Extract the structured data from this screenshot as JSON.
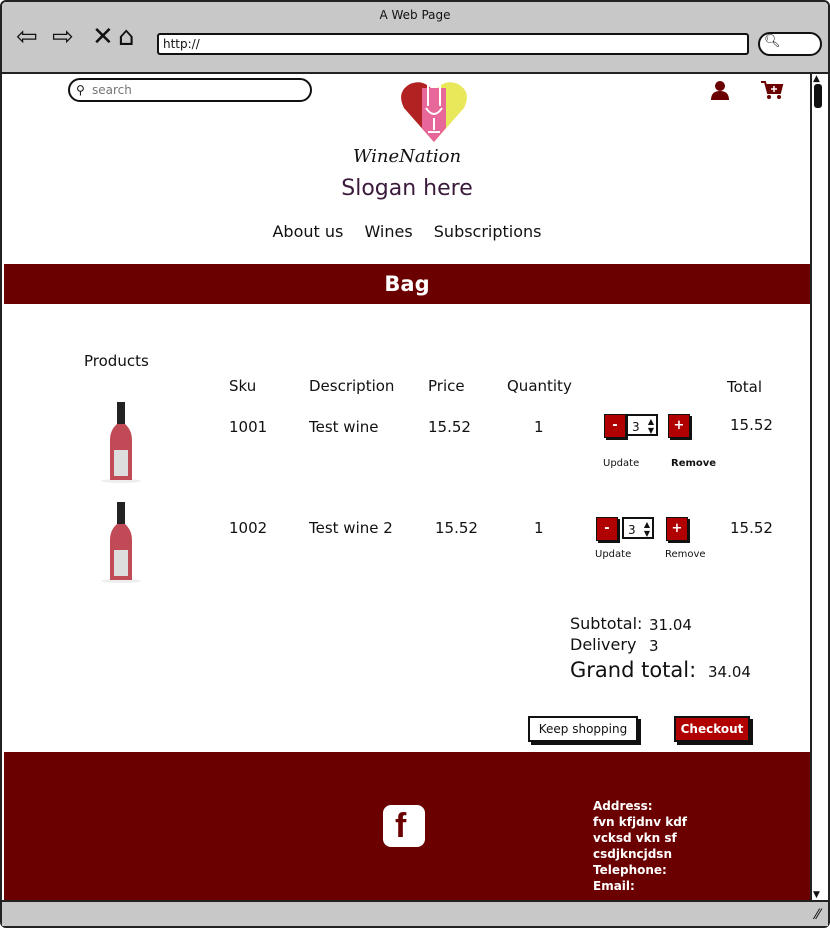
{
  "window": {
    "title": "A Web Page",
    "url": "http://"
  },
  "header": {
    "search_placeholder": "search",
    "brand": "WineNation",
    "slogan": "Slogan here",
    "nav": [
      "About us",
      "Wines",
      "Subscriptions"
    ]
  },
  "bag": {
    "title": "Bag",
    "products_label": "Products",
    "columns": {
      "sku": "Sku",
      "description": "Description",
      "price": "Price",
      "quantity": "Quantity",
      "total": "Total"
    },
    "items": [
      {
        "sku": "1001",
        "description": "Test wine",
        "price": "15.52",
        "quantity": "1",
        "stepper_value": "3",
        "total": "15.52",
        "update": "Update",
        "remove": "Remove"
      },
      {
        "sku": "1002",
        "description": "Test wine 2",
        "price": "15.52",
        "quantity": "1",
        "stepper_value": "3",
        "total": "15.52",
        "update": "Update",
        "remove": "Remove"
      }
    ],
    "stepper": {
      "minus": "-",
      "plus": "+"
    },
    "summary": {
      "subtotal_label": "Subtotal:",
      "subtotal": "31.04",
      "delivery_label": "Delivery",
      "delivery": "3",
      "grand_label": "Grand total:",
      "grand": "34.04"
    },
    "keep_shopping": "Keep shopping",
    "checkout": "Checkout"
  },
  "footer": {
    "facebook": "f",
    "address_label": "Address:",
    "address_lines": [
      "fvn kfjdnv kdf",
      "vcksd vkn sf",
      "csdjkncjdsn"
    ],
    "telephone_label": "Telephone:",
    "email_label": "Email:"
  },
  "colors": {
    "brand_dark": "#6b0000",
    "button_red": "#b00000"
  },
  "icons": [
    "back-icon",
    "forward-icon",
    "stop-icon",
    "home-icon",
    "search-icon",
    "user-icon",
    "cart-icon",
    "facebook-icon"
  ]
}
